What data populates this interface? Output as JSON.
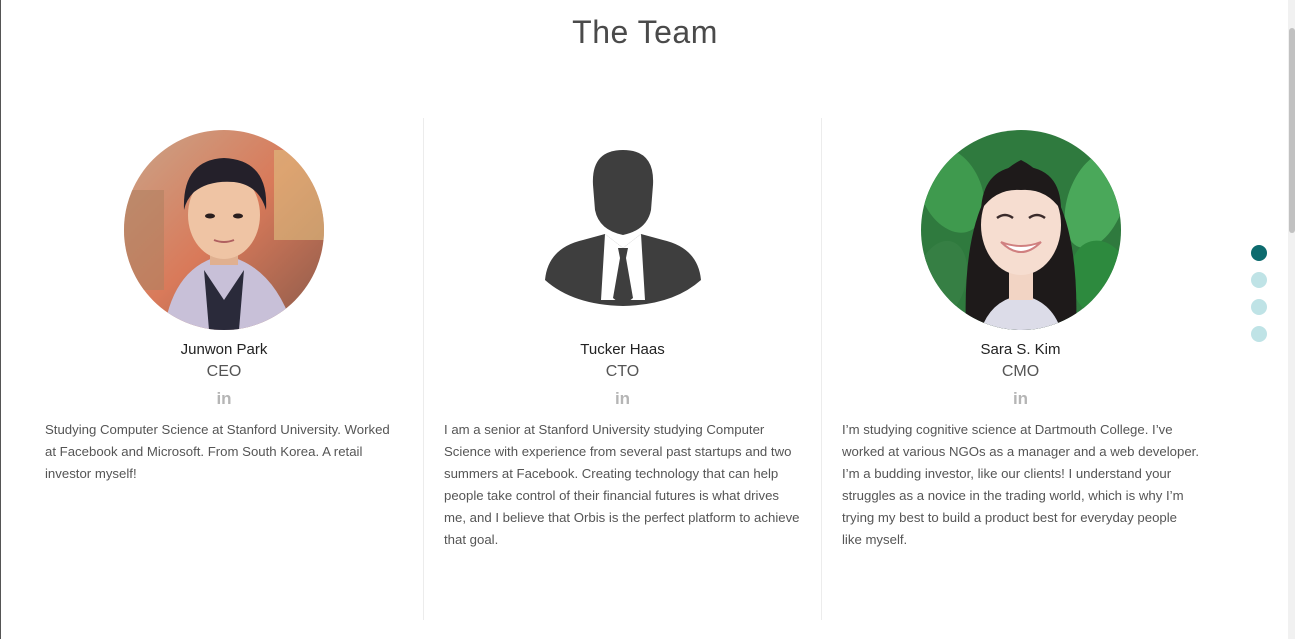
{
  "section": {
    "title": "The Team"
  },
  "members": [
    {
      "name": "Junwon Park",
      "role": "CEO",
      "linkedin_label": "in",
      "bio": "Studying Computer Science at Stanford University. Worked at Facebook and Microsoft. From South Korea. A retail investor myself!",
      "photo_icon": "portrait-photo"
    },
    {
      "name": "Tucker Haas",
      "role": "CTO",
      "linkedin_label": "in",
      "bio": "I am a senior at Stanford University studying Computer Science with experience from several past startups and two summers at Facebook. Creating technology that can help people take control of their financial futures is what drives me, and I believe that Orbis is the perfect platform to achieve that goal.",
      "photo_icon": "person-silhouette-icon"
    },
    {
      "name": "Sara S. Kim",
      "role": "CMO",
      "linkedin_label": "in",
      "bio": "I’m studying cognitive science at Dartmouth College. I’ve worked at various NGOs as a manager and a web developer. I’m a budding investor, like our clients! I understand your struggles as a novice in the trading world, which is why I’m trying my best to build a product best for everyday people like myself.",
      "photo_icon": "portrait-photo"
    }
  ],
  "page_nav": {
    "active_index": 0,
    "count": 4
  },
  "colors": {
    "accent": "#0d6b6e",
    "dot_inactive": "#bfe3e6",
    "icon_gray": "#b5b5b5"
  }
}
